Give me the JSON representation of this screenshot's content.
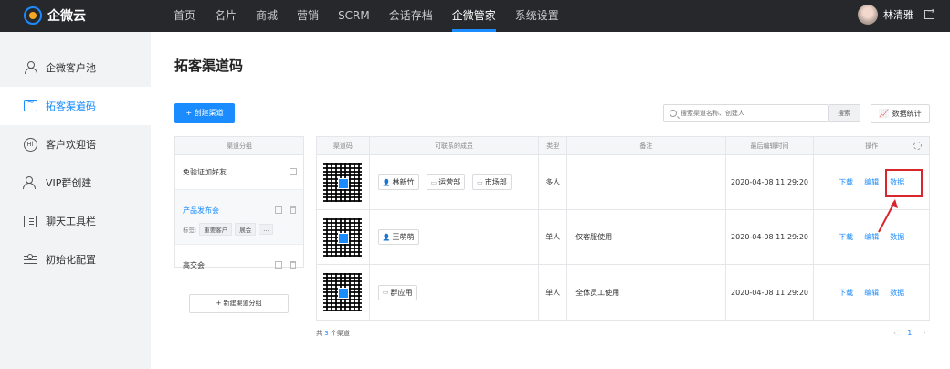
{
  "brand": {
    "name": "企微云"
  },
  "nav": {
    "items": [
      "首页",
      "名片",
      "商城",
      "营销",
      "SCRM",
      "会话存档",
      "企微管家",
      "系统设置"
    ],
    "active_index": 6
  },
  "user": {
    "name": "林清雅"
  },
  "sidebar": {
    "items": [
      {
        "label": "企微客户池",
        "icon": "person-icon"
      },
      {
        "label": "拓客渠道码",
        "icon": "chat-icon"
      },
      {
        "label": "客户欢迎语",
        "icon": "hi-icon"
      },
      {
        "label": "VIP群创建",
        "icon": "group-icon"
      },
      {
        "label": "聊天工具栏",
        "icon": "book-icon"
      },
      {
        "label": "初始化配置",
        "icon": "slider-icon"
      }
    ],
    "active_index": 1
  },
  "page": {
    "title": "拓客渠道码",
    "create_button": "+ 创建渠道",
    "search_placeholder": "搜索渠道名称、创建人",
    "search_button": "搜索",
    "stats_button": "数据统计"
  },
  "groups": {
    "header": "渠道分组",
    "items": [
      {
        "name": "免验证加好友"
      },
      {
        "name": "产品发布会",
        "tags_label": "标签:",
        "tags": [
          "重要客户",
          "展会",
          "..."
        ]
      },
      {
        "name": "高交会"
      }
    ],
    "new_button": "+ 新建渠道分组"
  },
  "table": {
    "headers": [
      "渠道码",
      "可联系的成员",
      "类型",
      "备注",
      "最后编辑时间",
      "操作"
    ],
    "rows": [
      {
        "members": [
          {
            "label": "林新竹",
            "icon": "user-icon"
          },
          {
            "label": "运营部",
            "icon": "folder-icon"
          },
          {
            "label": "市场部",
            "icon": "folder-icon"
          }
        ],
        "type": "多人",
        "note": "",
        "time": "2020-04-08 11:29:20",
        "actions": [
          "下载",
          "编辑",
          "数据"
        ]
      },
      {
        "members": [
          {
            "label": "王萌萌",
            "icon": "user-icon"
          }
        ],
        "type": "单人",
        "note": "仅客服使用",
        "time": "2020-04-08 11:29:20",
        "actions": [
          "下载",
          "编辑",
          "数据"
        ]
      },
      {
        "members": [
          {
            "label": "群应用",
            "icon": "folder-icon"
          }
        ],
        "type": "单人",
        "note": "全体员工使用",
        "time": "2020-04-08 11:29:20",
        "actions": [
          "下载",
          "编辑",
          "数据"
        ]
      }
    ]
  },
  "footer": {
    "prefix": "共",
    "count": "3",
    "suffix": "个渠道"
  },
  "pager": {
    "prev": "‹",
    "page": "1",
    "next": "›"
  },
  "colors": {
    "accent": "#1a8cff",
    "highlight": "#d8262e",
    "topbar": "#27282c"
  }
}
